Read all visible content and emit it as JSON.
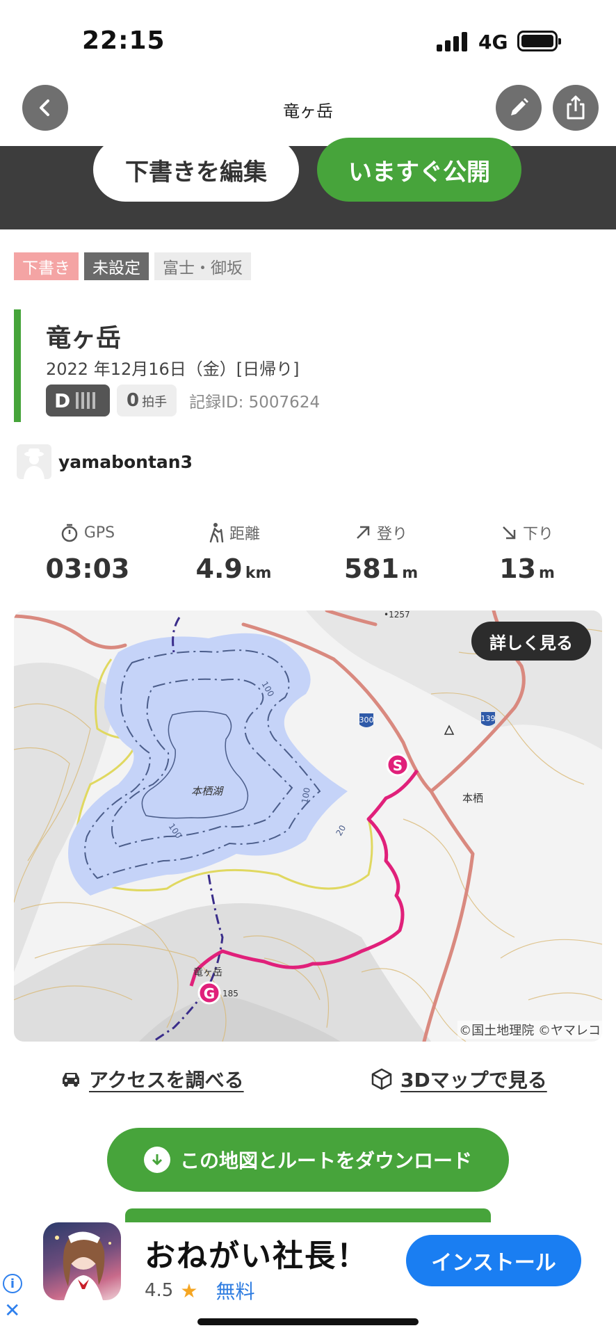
{
  "status_bar": {
    "time": "22:15",
    "network": "4G"
  },
  "nav": {
    "title": "竜ヶ岳"
  },
  "actions": {
    "edit_draft": "下書きを編集",
    "publish_now": "いますぐ公開"
  },
  "tags": [
    "下書き",
    "未設定",
    "富士・御坂"
  ],
  "record": {
    "title": "竜ヶ岳",
    "date": "2022 年12月16日（金）[日帰り]",
    "difficulty": "D",
    "claps": "0",
    "claps_unit": "拍手",
    "record_id": "記録ID: 5007624"
  },
  "user": {
    "name": "yamabontan3"
  },
  "stats": [
    {
      "label": "GPS",
      "value": "03:03",
      "unit": ""
    },
    {
      "label": "距離",
      "value": "4.9",
      "unit": "km"
    },
    {
      "label": "登り",
      "value": "581",
      "unit": "m"
    },
    {
      "label": "下り",
      "value": "13",
      "unit": "m"
    }
  ],
  "map": {
    "details_button": "詳しく見る",
    "credit": "©国土地理院 ©ヤマレコ",
    "labels": {
      "lake": "本栖湖",
      "village": "本栖",
      "peak": "竜ヶ岳",
      "peak_elev": "185",
      "elev_1257": "•1257",
      "route_300": "300",
      "route_139": "139",
      "contour_100a": "100",
      "contour_100b": "100",
      "contour_100c": "100",
      "contour_20": "20",
      "start": "S",
      "goal": "G"
    },
    "colors": {
      "route": "#e0207a",
      "lake": "#c5d3f8",
      "road": "#d9897f",
      "shore": "#e0d860"
    }
  },
  "links": {
    "access": "アクセスを調べる",
    "map3d": "3Dマップで見る"
  },
  "download": {
    "label": "この地図とルートをダウンロード"
  },
  "ad": {
    "title": "おねがい社長！",
    "rating": "4.5",
    "price": "無料",
    "install": "インストール",
    "info": "i",
    "close": "✕"
  }
}
